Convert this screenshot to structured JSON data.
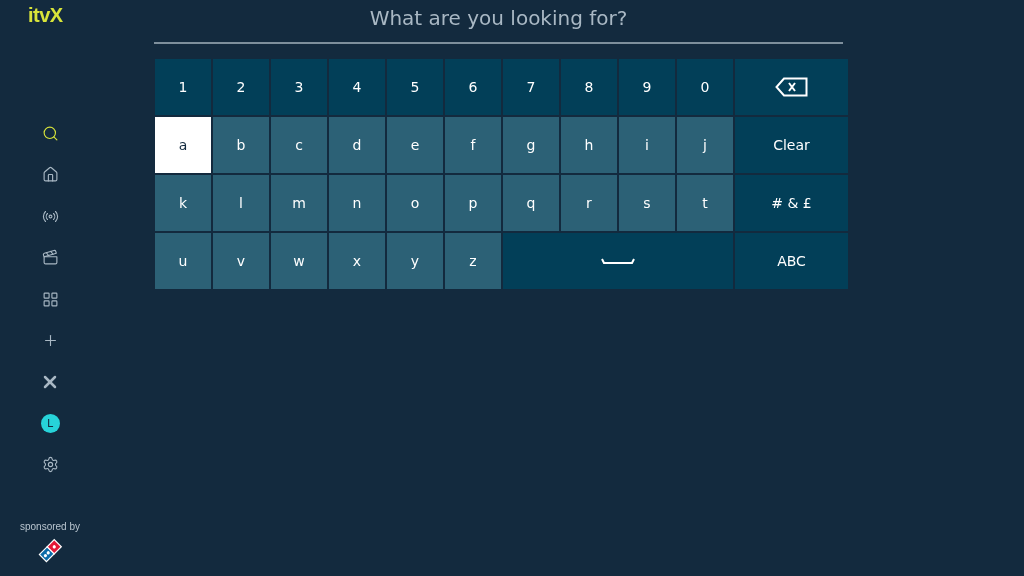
{
  "logo": "itvX",
  "nav": [
    {
      "kind": "search",
      "selected": true
    },
    {
      "kind": "home",
      "selected": false
    },
    {
      "kind": "live",
      "selected": false
    },
    {
      "kind": "films",
      "selected": false
    },
    {
      "kind": "categories",
      "selected": false
    },
    {
      "kind": "add",
      "selected": false
    },
    {
      "kind": "x",
      "selected": false
    },
    {
      "kind": "profile",
      "label": "L",
      "selected": false
    },
    {
      "kind": "settings",
      "selected": false
    }
  ],
  "sponsor": {
    "label": "sponsored by"
  },
  "search": {
    "placeholder": "What are you looking for?"
  },
  "keyboard": {
    "keys": [
      [
        {
          "kind": "digit",
          "label": "1",
          "selected": false
        },
        {
          "kind": "digit",
          "label": "2",
          "selected": false
        },
        {
          "kind": "digit",
          "label": "3",
          "selected": false
        },
        {
          "kind": "digit",
          "label": "4",
          "selected": false
        },
        {
          "kind": "digit",
          "label": "5",
          "selected": false
        },
        {
          "kind": "digit",
          "label": "6",
          "selected": false
        },
        {
          "kind": "digit",
          "label": "7",
          "selected": false
        },
        {
          "kind": "digit",
          "label": "8",
          "selected": false
        },
        {
          "kind": "digit",
          "label": "9",
          "selected": false
        },
        {
          "kind": "digit",
          "label": "0",
          "selected": false
        }
      ],
      [
        {
          "kind": "letter",
          "label": "a",
          "selected": true
        },
        {
          "kind": "letter",
          "label": "b",
          "selected": false
        },
        {
          "kind": "letter",
          "label": "c",
          "selected": false
        },
        {
          "kind": "letter",
          "label": "d",
          "selected": false
        },
        {
          "kind": "letter",
          "label": "e",
          "selected": false
        },
        {
          "kind": "letter",
          "label": "f",
          "selected": false
        },
        {
          "kind": "letter",
          "label": "g",
          "selected": false
        },
        {
          "kind": "letter",
          "label": "h",
          "selected": false
        },
        {
          "kind": "letter",
          "label": "i",
          "selected": false
        },
        {
          "kind": "letter",
          "label": "j",
          "selected": false
        }
      ],
      [
        {
          "kind": "letter",
          "label": "k",
          "selected": false
        },
        {
          "kind": "letter",
          "label": "l",
          "selected": false
        },
        {
          "kind": "letter",
          "label": "m",
          "selected": false
        },
        {
          "kind": "letter",
          "label": "n",
          "selected": false
        },
        {
          "kind": "letter",
          "label": "o",
          "selected": false
        },
        {
          "kind": "letter",
          "label": "p",
          "selected": false
        },
        {
          "kind": "letter",
          "label": "q",
          "selected": false
        },
        {
          "kind": "letter",
          "label": "r",
          "selected": false
        },
        {
          "kind": "letter",
          "label": "s",
          "selected": false
        },
        {
          "kind": "letter",
          "label": "t",
          "selected": false
        }
      ],
      [
        {
          "kind": "letter",
          "label": "u",
          "selected": false
        },
        {
          "kind": "letter",
          "label": "v",
          "selected": false
        },
        {
          "kind": "letter",
          "label": "w",
          "selected": false
        },
        {
          "kind": "letter",
          "label": "x",
          "selected": false
        },
        {
          "kind": "letter",
          "label": "y",
          "selected": false
        },
        {
          "kind": "letter",
          "label": "z",
          "selected": false
        },
        {
          "kind": "space",
          "selected": false
        }
      ]
    ],
    "side_keys": [
      {
        "kind": "backspace",
        "selected": false
      },
      {
        "kind": "action",
        "label": "Clear",
        "selected": false
      },
      {
        "kind": "action",
        "label": "# & £",
        "selected": false
      },
      {
        "kind": "action",
        "label": "ABC",
        "selected": false
      }
    ]
  }
}
